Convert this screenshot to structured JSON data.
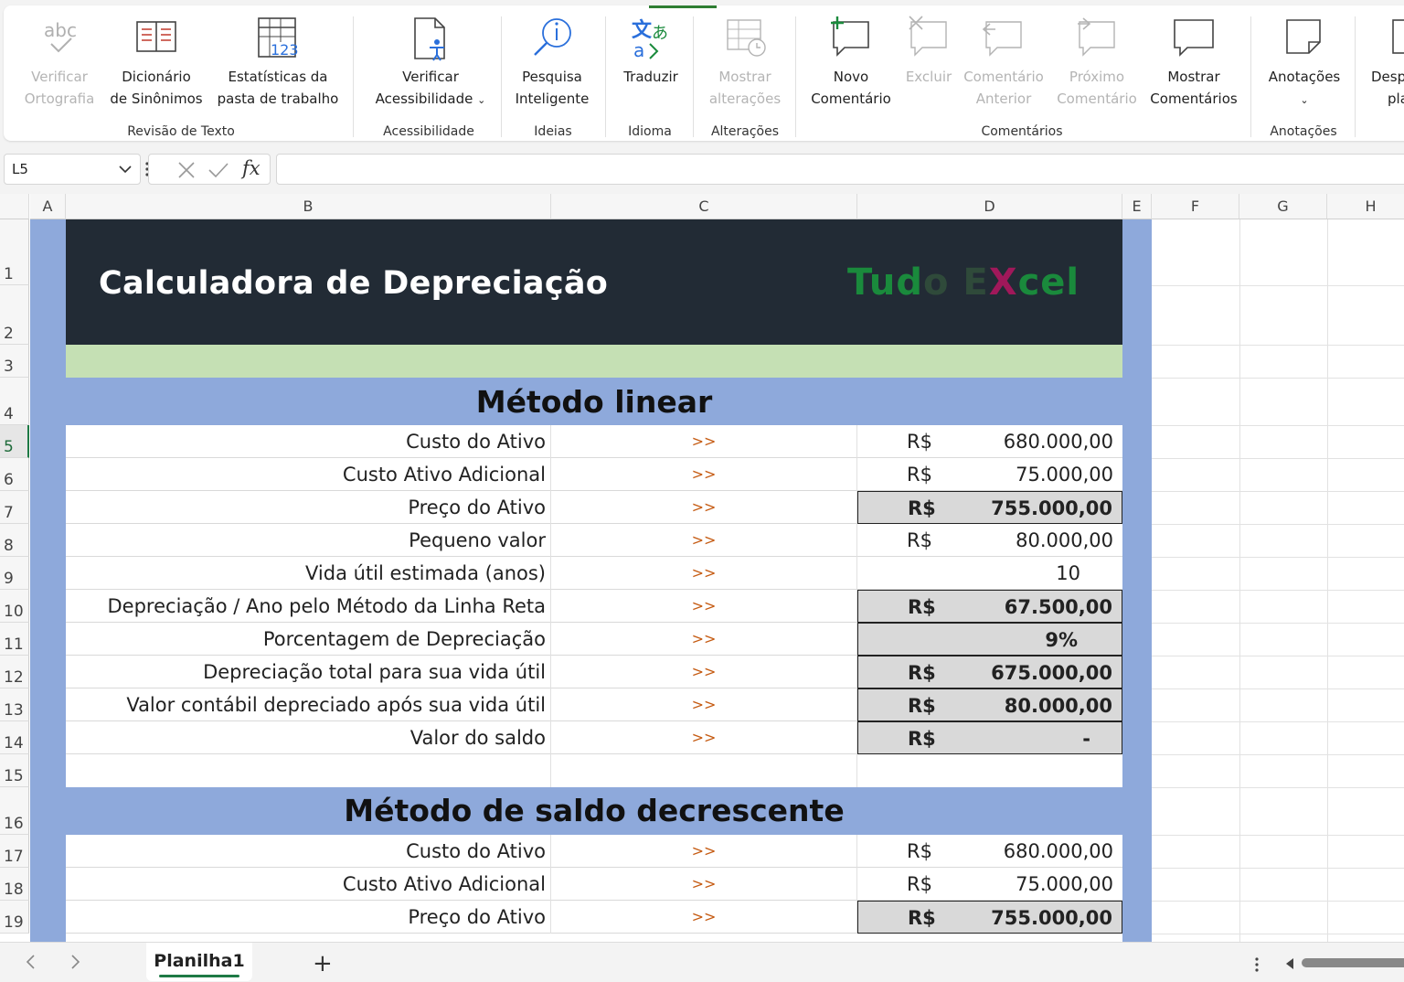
{
  "ribbon": {
    "buttons": [
      {
        "line1": "Verificar",
        "line2": "Ortografia",
        "icon": "abc-check-icon",
        "icon_text": "abc"
      },
      {
        "line1": "Dicionário",
        "line2": "de Sinônimos",
        "icon": "thesaurus-book-icon"
      },
      {
        "line1": "Estatísticas da",
        "line2": "pasta de trabalho",
        "icon": "workbook-statistics-icon",
        "icon_text": "123"
      },
      {
        "line1": "Verificar",
        "line2": "Acessibilidade",
        "icon": "accessibility-check-icon"
      },
      {
        "line1": "Pesquisa",
        "line2": "Inteligente",
        "icon": "smart-lookup-icon"
      },
      {
        "line1": "Traduzir",
        "line2": "",
        "icon": "translate-icon"
      },
      {
        "line1": "Mostrar",
        "line2": "alterações",
        "icon": "show-changes-icon"
      },
      {
        "line1": "Novo",
        "line2": "Comentário",
        "icon": "new-comment-icon"
      },
      {
        "line1": "Excluir",
        "line2": "",
        "icon": "delete-comment-icon"
      },
      {
        "line1": "Comentário",
        "line2": "Anterior",
        "icon": "previous-comment-icon"
      },
      {
        "line1": "Próximo",
        "line2": "Comentário",
        "icon": "next-comment-icon"
      },
      {
        "line1": "Mostrar",
        "line2": "Comentários",
        "icon": "show-comments-icon"
      },
      {
        "line1": "Anotações",
        "line2": "",
        "icon": "notes-icon"
      },
      {
        "line1": "Desp",
        "line2": "pla",
        "icon": "unprotect-sheet-icon"
      }
    ],
    "groups": [
      "Revisão de Texto",
      "Acessibilidade",
      "Ideias",
      "Idioma",
      "Alterações",
      "Comentários",
      "Anotações"
    ]
  },
  "formula_bar": {
    "name_box": "L5",
    "formula": "",
    "fx_label": "fx"
  },
  "columns": [
    "A",
    "B",
    "C",
    "D",
    "E",
    "F",
    "G",
    "H"
  ],
  "rows": [
    "1",
    "2",
    "3",
    "4",
    "5",
    "6",
    "7",
    "8",
    "9",
    "10",
    "11",
    "12",
    "13",
    "14",
    "15",
    "16",
    "17",
    "18",
    "19"
  ],
  "selected_row": "5",
  "sheet": {
    "title": "Calculadora de Depreciação",
    "logo": {
      "part1": "Tud",
      "part2": "o E",
      "part3": "X",
      "part4": "cel"
    },
    "section1": {
      "title": "Método linear",
      "rows": [
        {
          "label": "Custo do Ativo",
          "arrow": ">>",
          "currency": "R$",
          "value": "680.000,00",
          "bold": false
        },
        {
          "label": "Custo Ativo Adicional",
          "arrow": ">>",
          "currency": "R$",
          "value": "75.000,00",
          "bold": false
        },
        {
          "label": "Preço do Ativo",
          "arrow": ">>",
          "currency": "R$",
          "value": "755.000,00",
          "bold": true
        },
        {
          "label": "Pequeno valor",
          "arrow": ">>",
          "currency": "R$",
          "value": "80.000,00",
          "bold": false
        },
        {
          "label": "Vida útil estimada (anos)",
          "arrow": ">>",
          "currency": "",
          "value": "10",
          "bold": false
        },
        {
          "label": "Depreciação / Ano pelo Método da Linha Reta",
          "arrow": ">>",
          "currency": "R$",
          "value": "67.500,00",
          "bold": true
        },
        {
          "label": "Porcentagem de Depreciação",
          "arrow": ">>",
          "currency": "",
          "value": "9%",
          "bold": true
        },
        {
          "label": "Depreciação total para sua vida útil",
          "arrow": ">>",
          "currency": "R$",
          "value": "675.000,00",
          "bold": true
        },
        {
          "label": "Valor contábil depreciado após sua vida útil",
          "arrow": ">>",
          "currency": "R$",
          "value": "80.000,00",
          "bold": true
        },
        {
          "label": "Valor do saldo",
          "arrow": ">>",
          "currency": "R$",
          "value": "-",
          "bold": true
        }
      ]
    },
    "section2": {
      "title": "Método de saldo decrescente",
      "rows": [
        {
          "label": "Custo do Ativo",
          "arrow": ">>",
          "currency": "R$",
          "value": "680.000,00",
          "bold": false
        },
        {
          "label": "Custo Ativo Adicional",
          "arrow": ">>",
          "currency": "R$",
          "value": "75.000,00",
          "bold": false
        },
        {
          "label": "Preço do Ativo",
          "arrow": ">>",
          "currency": "R$",
          "value": "755.000,00",
          "bold": true
        }
      ]
    }
  },
  "sheet_tabs": {
    "active": "Planilha1",
    "add": "+"
  }
}
